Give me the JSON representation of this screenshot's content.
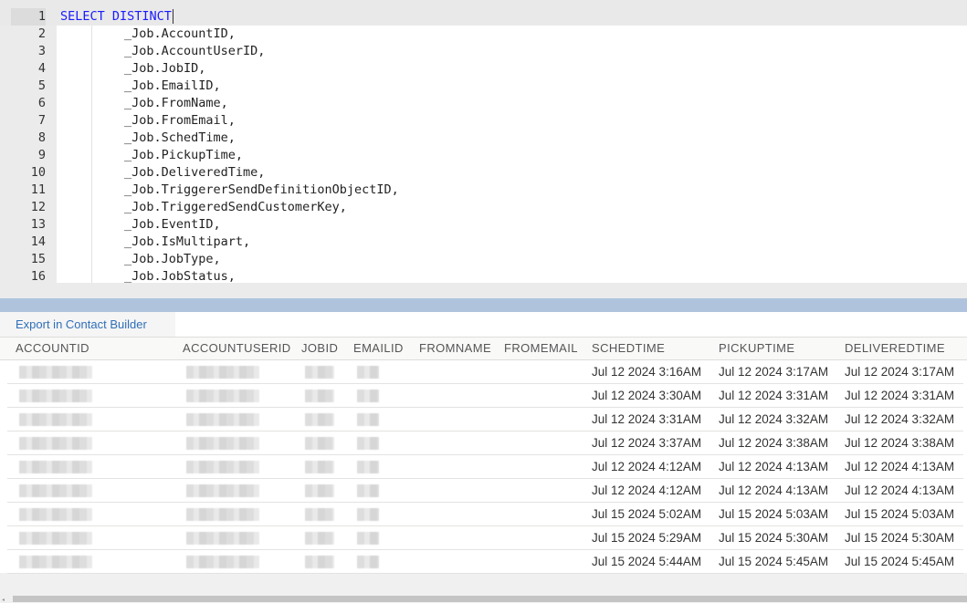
{
  "editor": {
    "lines": [
      {
        "n": "1",
        "keyword": "SELECT DISTINCT",
        "text": ""
      },
      {
        "n": "2",
        "text": "_Job.AccountID,"
      },
      {
        "n": "3",
        "text": "_Job.AccountUserID,"
      },
      {
        "n": "4",
        "text": "_Job.JobID,"
      },
      {
        "n": "5",
        "text": "_Job.EmailID,"
      },
      {
        "n": "6",
        "text": "_Job.FromName,"
      },
      {
        "n": "7",
        "text": "_Job.FromEmail,"
      },
      {
        "n": "8",
        "text": "_Job.SchedTime,"
      },
      {
        "n": "9",
        "text": "_Job.PickupTime,"
      },
      {
        "n": "10",
        "text": "_Job.DeliveredTime,"
      },
      {
        "n": "11",
        "text": "_Job.TriggererSendDefinitionObjectID,"
      },
      {
        "n": "12",
        "text": "_Job.TriggeredSendCustomerKey,"
      },
      {
        "n": "13",
        "text": "_Job.EventID,"
      },
      {
        "n": "14",
        "text": "_Job.IsMultipart,"
      },
      {
        "n": "15",
        "text": "_Job.JobType,"
      },
      {
        "n": "16",
        "text": "_Job.JobStatus,"
      }
    ]
  },
  "results": {
    "tab_label": "Export in Contact Builder",
    "columns": [
      "ACCOUNTID",
      "ACCOUNTUSERID",
      "JOBID",
      "EMAILID",
      "FROMNAME",
      "FROMEMAIL",
      "SCHEDTIME",
      "PICKUPTIME",
      "DELIVEREDTIME"
    ],
    "rows": [
      {
        "accountid": "[redacted]",
        "accountuserid": "[redacted]",
        "jobid": "[redacted]",
        "emailid": "[redacted]",
        "fromname": "",
        "fromemail": "",
        "schedtime": "Jul 12 2024 3:16AM",
        "pickuptime": "Jul 12 2024 3:17AM",
        "deliveredtime": "Jul 12 2024 3:17AM"
      },
      {
        "accountid": "[redacted]",
        "accountuserid": "[redacted]",
        "jobid": "[redacted]",
        "emailid": "[redacted]",
        "fromname": "",
        "fromemail": "",
        "schedtime": "Jul 12 2024 3:30AM",
        "pickuptime": "Jul 12 2024 3:31AM",
        "deliveredtime": "Jul 12 2024 3:31AM"
      },
      {
        "accountid": "[redacted]",
        "accountuserid": "[redacted]",
        "jobid": "[redacted]",
        "emailid": "[redacted]",
        "fromname": "",
        "fromemail": "",
        "schedtime": "Jul 12 2024 3:31AM",
        "pickuptime": "Jul 12 2024 3:32AM",
        "deliveredtime": "Jul 12 2024 3:32AM"
      },
      {
        "accountid": "[redacted]",
        "accountuserid": "[redacted]",
        "jobid": "[redacted]",
        "emailid": "[redacted]",
        "fromname": "",
        "fromemail": "",
        "schedtime": "Jul 12 2024 3:37AM",
        "pickuptime": "Jul 12 2024 3:38AM",
        "deliveredtime": "Jul 12 2024 3:38AM"
      },
      {
        "accountid": "[redacted]",
        "accountuserid": "[redacted]",
        "jobid": "[redacted]",
        "emailid": "[redacted]",
        "fromname": "",
        "fromemail": "",
        "schedtime": "Jul 12 2024 4:12AM",
        "pickuptime": "Jul 12 2024 4:13AM",
        "deliveredtime": "Jul 12 2024 4:13AM"
      },
      {
        "accountid": "[redacted]",
        "accountuserid": "[redacted]",
        "jobid": "[redacted]",
        "emailid": "[redacted]",
        "fromname": "",
        "fromemail": "",
        "schedtime": "Jul 12 2024 4:12AM",
        "pickuptime": "Jul 12 2024 4:13AM",
        "deliveredtime": "Jul 12 2024 4:13AM"
      },
      {
        "accountid": "[redacted]",
        "accountuserid": "[redacted]",
        "jobid": "[redacted]",
        "emailid": "[redacted]",
        "fromname": "",
        "fromemail": "",
        "schedtime": "Jul 15 2024 5:02AM",
        "pickuptime": "Jul 15 2024 5:03AM",
        "deliveredtime": "Jul 15 2024 5:03AM"
      },
      {
        "accountid": "[redacted]",
        "accountuserid": "[redacted]",
        "jobid": "[redacted]",
        "emailid": "[redacted]",
        "fromname": "",
        "fromemail": "",
        "schedtime": "Jul 15 2024 5:29AM",
        "pickuptime": "Jul 15 2024 5:30AM",
        "deliveredtime": "Jul 15 2024 5:30AM"
      },
      {
        "accountid": "[redacted]",
        "accountuserid": "[redacted]",
        "jobid": "[redacted]",
        "emailid": "[redacted]",
        "fromname": "",
        "fromemail": "",
        "schedtime": "Jul 15 2024 5:44AM",
        "pickuptime": "Jul 15 2024 5:45AM",
        "deliveredtime": "Jul 15 2024 5:45AM"
      }
    ]
  },
  "colors": {
    "keyword": "#1a1aff",
    "link": "#2f6fb8",
    "splitter": "#afc3dd",
    "gutter": "#ebebeb"
  }
}
